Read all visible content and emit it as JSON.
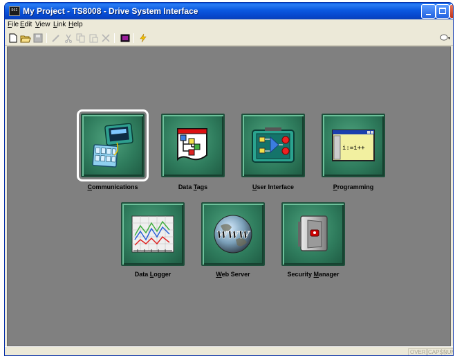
{
  "window": {
    "title": "My Project - TS8008 - Drive System Interface",
    "icon_text": "DSI",
    "controls": {
      "minimize": "minimize-icon",
      "maximize": "maximize-icon",
      "close": "close-icon"
    }
  },
  "menubar": {
    "items": [
      {
        "label": "File",
        "mnemonic": "F"
      },
      {
        "label": "Edit",
        "mnemonic": "E"
      },
      {
        "label": "View",
        "mnemonic": "V"
      },
      {
        "label": "Link",
        "mnemonic": "L"
      },
      {
        "label": "Help",
        "mnemonic": "H"
      }
    ]
  },
  "toolbar": {
    "buttons": [
      "new-icon",
      "open-icon",
      "save-icon",
      "edit-icon",
      "cut-icon",
      "copy-icon",
      "paste-icon",
      "delete-icon",
      "monitor-icon",
      "lightning-icon",
      "comment-icon"
    ]
  },
  "tiles": [
    {
      "label": "Communications",
      "mnemonic": "C",
      "icon": "communications-icon",
      "selected": true
    },
    {
      "label": "Data Tags",
      "mnemonic": "T",
      "icon": "data-tags-icon"
    },
    {
      "label": "User Interface",
      "mnemonic": "U",
      "icon": "user-interface-icon"
    },
    {
      "label": "Programming",
      "mnemonic": "P",
      "icon": "programming-icon",
      "code_text": "i:=i++"
    },
    {
      "label": "Data Logger",
      "mnemonic": "L",
      "icon": "data-logger-icon"
    },
    {
      "label": "Web Server",
      "mnemonic": "W",
      "icon": "web-server-icon",
      "globe_text": "WWW"
    },
    {
      "label": "Security Manager",
      "mnemonic": "M",
      "icon": "security-manager-icon"
    }
  ],
  "statusbar": {
    "indicators": [
      "OVER",
      "CAPS",
      "NUM"
    ]
  },
  "colors": {
    "titlebar": "#0a58e0",
    "workspace": "#808080",
    "tile": "#2f7c5d",
    "chrome": "#ece9d8"
  }
}
